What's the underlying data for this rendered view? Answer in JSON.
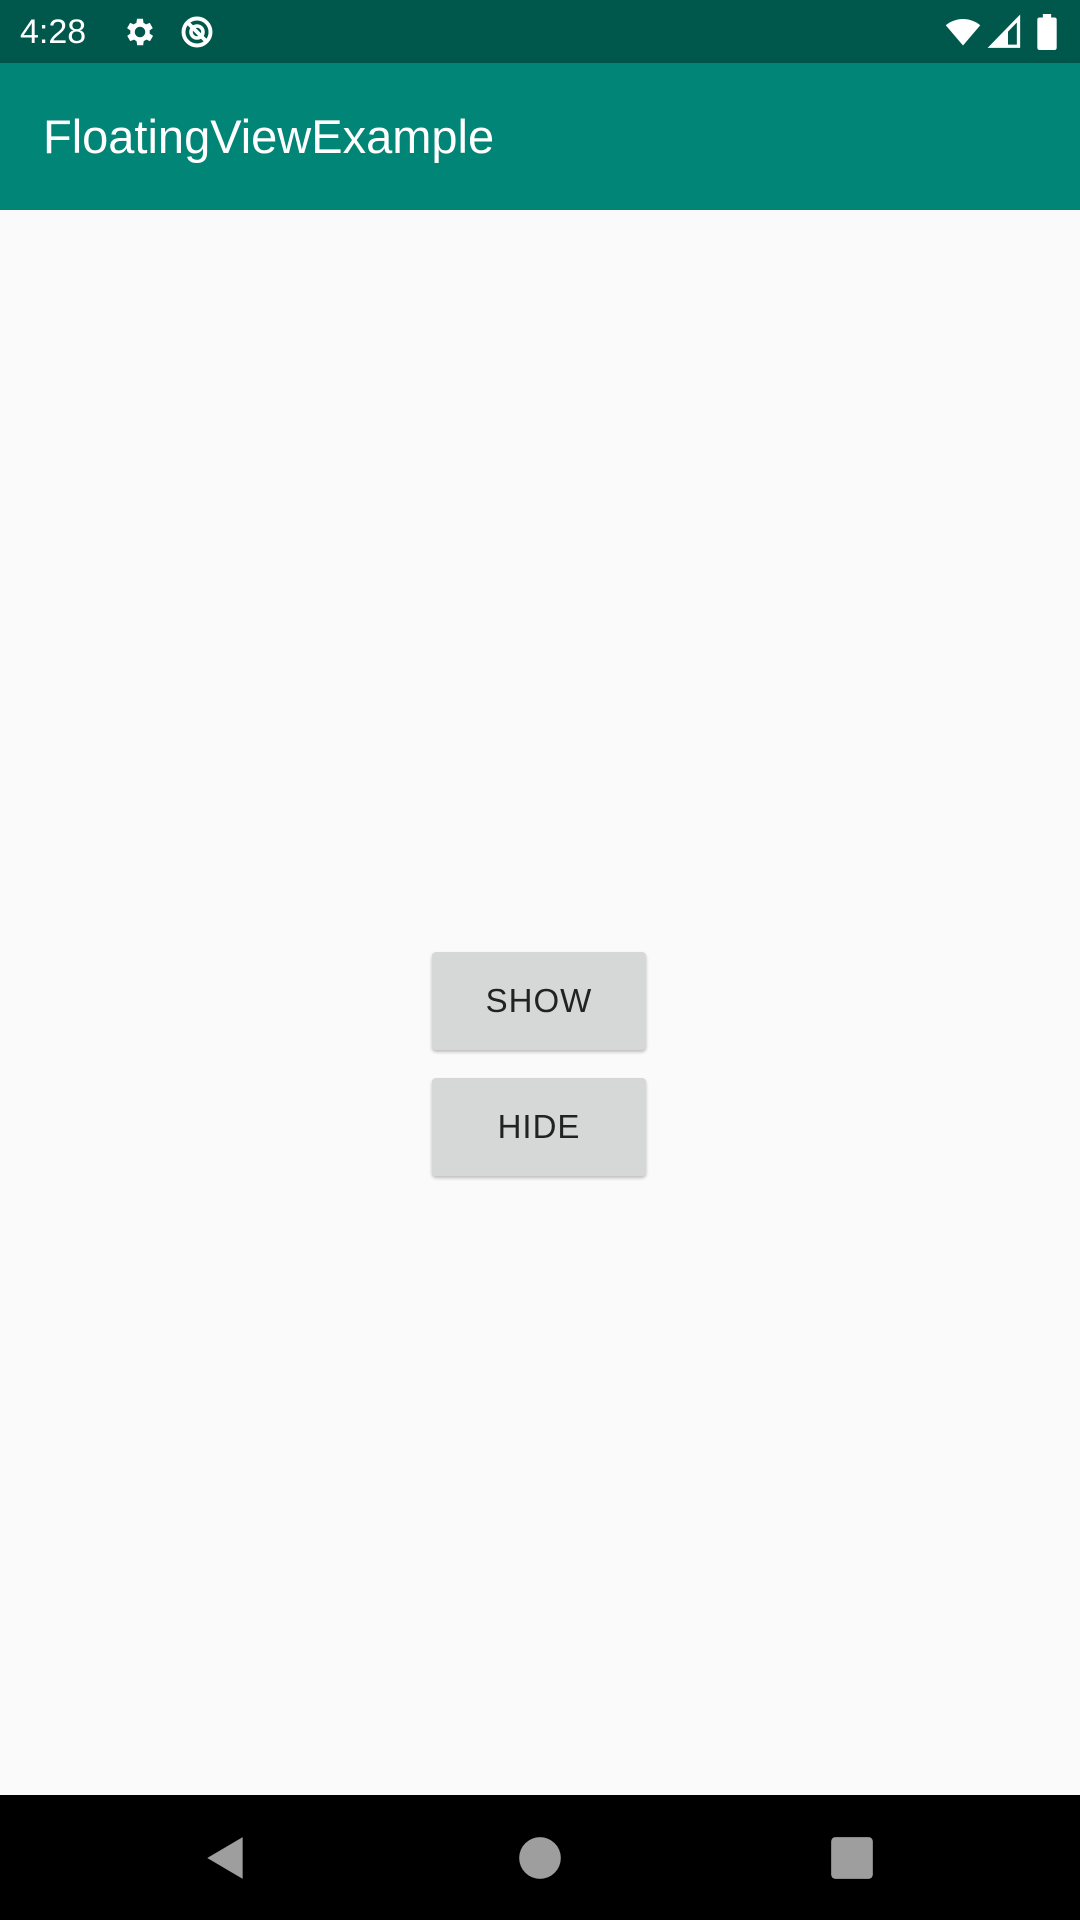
{
  "status_bar": {
    "time": "4:28",
    "icons": [
      "settings-icon",
      "sync-icon",
      "wifi-icon",
      "signal-icon",
      "battery-icon"
    ],
    "background": "#00574b"
  },
  "app_bar": {
    "title": "FloatingViewExample",
    "background": "#008577"
  },
  "main": {
    "buttons": {
      "show_label": "SHOW",
      "hide_label": "HIDE"
    },
    "button_color": "#d6d7d7"
  },
  "nav_bar": {
    "icons": [
      "back-icon",
      "home-icon",
      "recents-icon"
    ],
    "background": "#000000"
  }
}
